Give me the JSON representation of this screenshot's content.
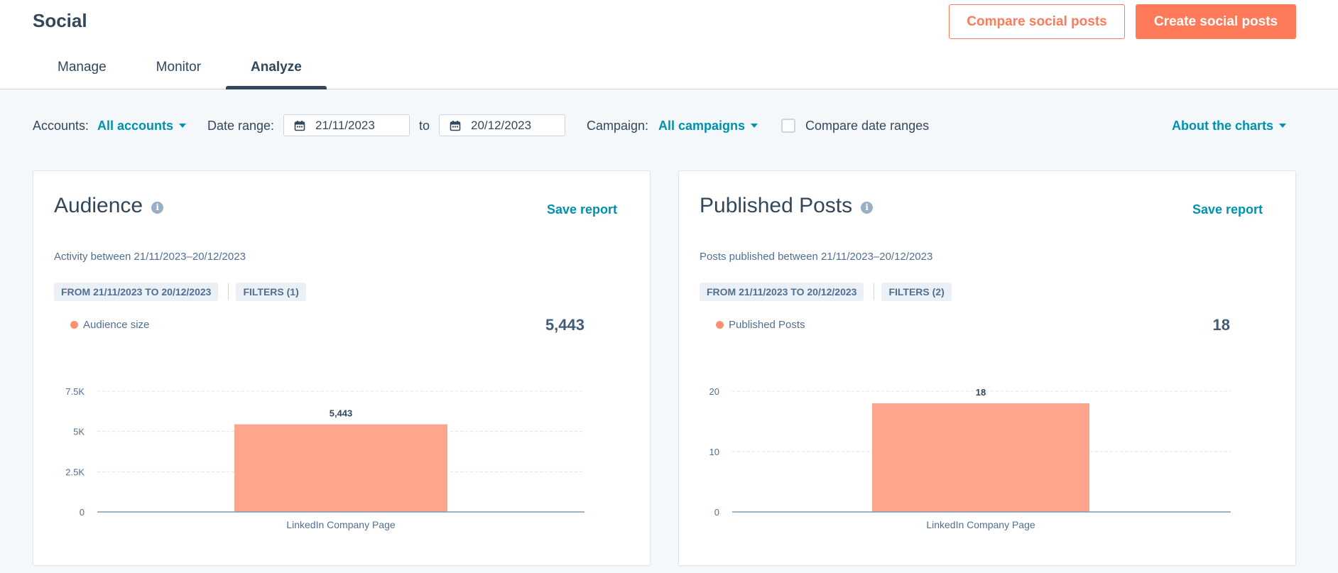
{
  "app": {
    "title": "Social"
  },
  "header": {
    "compare_button": "Compare social posts",
    "create_button": "Create social posts"
  },
  "tabs": [
    {
      "label": "Manage",
      "active": false
    },
    {
      "label": "Monitor",
      "active": false
    },
    {
      "label": "Analyze",
      "active": true
    }
  ],
  "filters": {
    "accounts_label": "Accounts:",
    "accounts_value": "All accounts",
    "date_range_label": "Date range:",
    "date_from": "21/11/2023",
    "to_label": "to",
    "date_to": "20/12/2023",
    "campaign_label": "Campaign:",
    "campaign_value": "All campaigns",
    "compare_label": "Compare date ranges",
    "compare_checked": false,
    "about_link": "About the charts"
  },
  "colors": {
    "accent": "#ff7a59",
    "link": "#0091ae",
    "bar": "#fea58e",
    "text": "#33475b"
  },
  "cards": [
    {
      "title": "Audience",
      "save_label": "Save report",
      "subtitle": "Activity between 21/11/2023–20/12/2023",
      "date_chip": "FROM 21/11/2023 TO 20/12/2023",
      "filters_chip": "FILTERS (1)",
      "legend": "Audience size",
      "total": "5,443"
    },
    {
      "title": "Published Posts",
      "save_label": "Save report",
      "subtitle": "Posts published between 21/11/2023–20/12/2023",
      "date_chip": "FROM 21/11/2023 TO 20/12/2023",
      "filters_chip": "FILTERS (2)",
      "legend": "Published Posts",
      "total": "18"
    }
  ],
  "chart_data": [
    {
      "type": "bar",
      "categories": [
        "LinkedIn Company Page"
      ],
      "values": [
        5443
      ],
      "value_labels": [
        "5,443"
      ],
      "series": [
        {
          "name": "Audience size",
          "values": [
            5443
          ]
        }
      ],
      "yticks": [
        0,
        2500,
        5000,
        7500
      ],
      "ytick_labels": [
        "0",
        "2.5K",
        "5K",
        "7.5K"
      ],
      "ylim": [
        0,
        7500
      ],
      "grid": true
    },
    {
      "type": "bar",
      "categories": [
        "LinkedIn Company Page"
      ],
      "values": [
        18
      ],
      "value_labels": [
        "18"
      ],
      "series": [
        {
          "name": "Published Posts",
          "values": [
            18
          ]
        }
      ],
      "yticks": [
        0,
        10,
        20
      ],
      "ytick_labels": [
        "0",
        "10",
        "20"
      ],
      "ylim": [
        0,
        20
      ],
      "grid": true
    }
  ]
}
